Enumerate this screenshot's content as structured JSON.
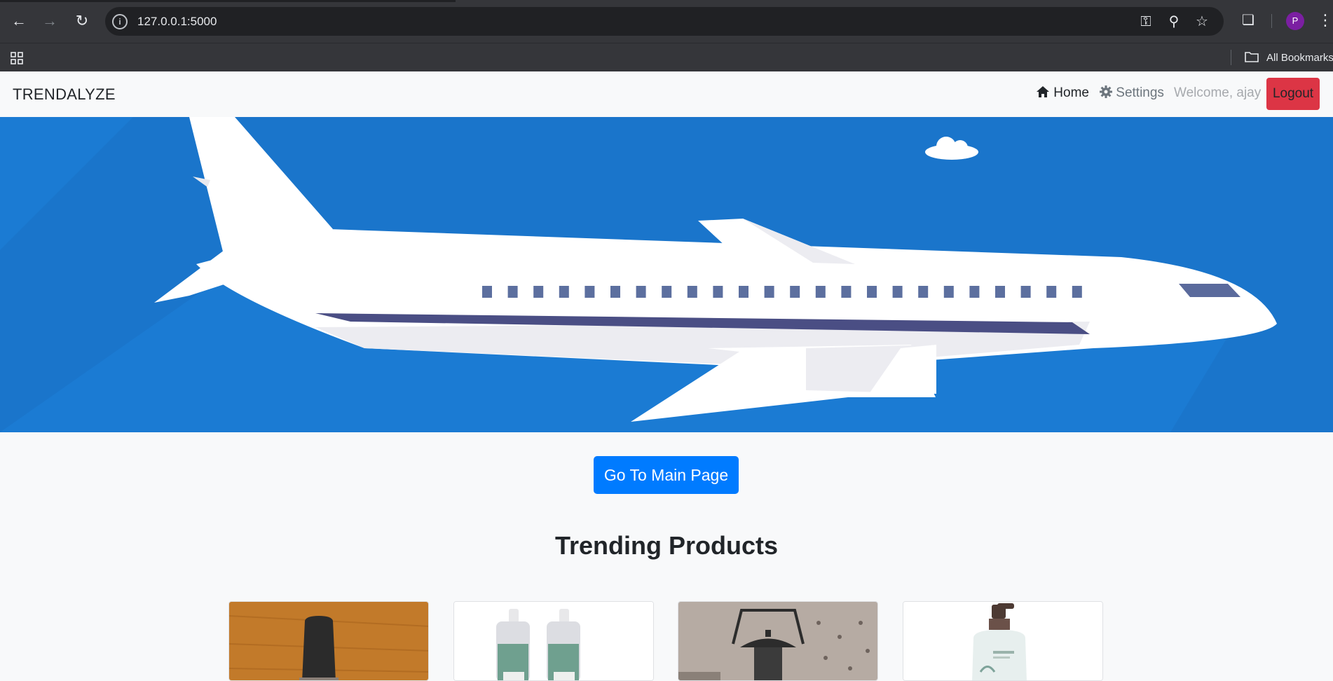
{
  "browser": {
    "url": "127.0.0.1:5000",
    "profile_initial": "P",
    "bookmarks_label": "All Bookmarks"
  },
  "navbar": {
    "brand": "TRENDALYZE",
    "home_label": "Home",
    "settings_label": "Settings",
    "welcome_text": "Welcome, ajay",
    "logout_label": "Logout"
  },
  "main": {
    "main_page_button": "Go To Main Page",
    "section_title": "Trending Products"
  },
  "products": [
    {
      "image": "nail-polish-bottle"
    },
    {
      "image": "spray-bottles"
    },
    {
      "image": "hanging-lantern"
    },
    {
      "image": "lotion-pump-bottle"
    }
  ],
  "colors": {
    "hero_sky": "#1b7bd3",
    "primary": "#007bff",
    "danger": "#dc3545"
  }
}
